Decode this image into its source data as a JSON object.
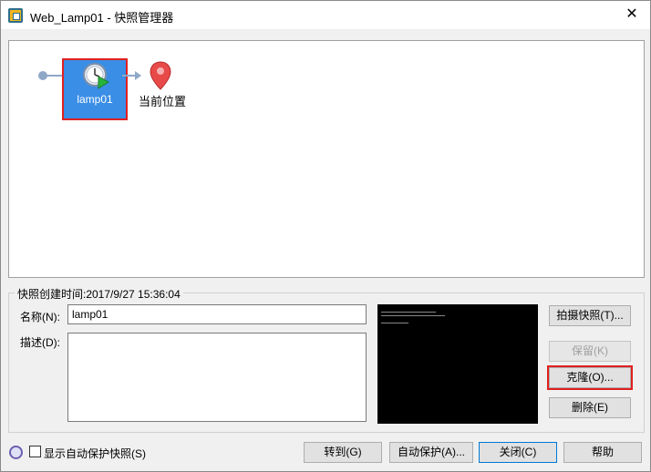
{
  "window": {
    "title": "Web_Lamp01 - 快照管理器",
    "close_glyph": "✕"
  },
  "tree": {
    "snapshot_label": "lamp01",
    "current_label": "当前位置"
  },
  "details": {
    "created_caption": "快照创建时间:2017/9/27 15:36:04",
    "name_label": "名称(N):",
    "name_value": "lamp01",
    "desc_label": "描述(D):",
    "desc_value": ""
  },
  "side_buttons": {
    "take": "拍摄快照(T)...",
    "keep": "保留(K)",
    "clone": "克隆(O)...",
    "delete": "删除(E)"
  },
  "bottom": {
    "show_auto": "显示自动保护快照(S)",
    "goto": "转到(G)",
    "autoprotect": "自动保护(A)...",
    "close": "关闭(C)",
    "help": "帮助"
  },
  "colors": {
    "selection": "#3a8ee6",
    "highlight": "#e02020",
    "line": "#8fa8c8"
  }
}
